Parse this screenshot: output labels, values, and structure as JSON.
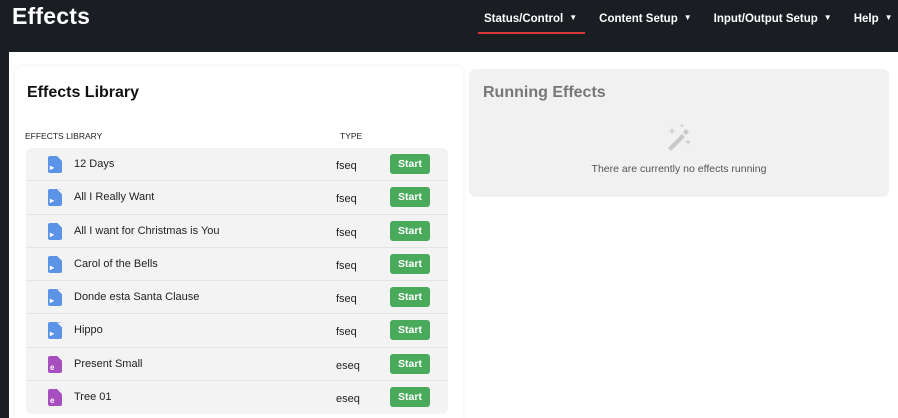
{
  "app": {
    "brand": "Effects"
  },
  "nav": [
    {
      "label": "Status/Control",
      "active": true
    },
    {
      "label": "Content Setup",
      "active": false
    },
    {
      "label": "Input/Output Setup",
      "active": false
    },
    {
      "label": "Help",
      "active": false
    }
  ],
  "caret": "▼",
  "library": {
    "title": "Effects Library",
    "col_name": "EFFECTS LIBRARY",
    "col_type": "TYPE",
    "start_label": "Start",
    "items": [
      {
        "name": "12 Days",
        "type": "fseq"
      },
      {
        "name": "All I Really Want",
        "type": "fseq"
      },
      {
        "name": "All I want for Christmas is You",
        "type": "fseq"
      },
      {
        "name": "Carol of the Bells",
        "type": "fseq"
      },
      {
        "name": "Donde esta Santa Clause",
        "type": "fseq"
      },
      {
        "name": "Hippo",
        "type": "fseq"
      },
      {
        "name": "Present Small",
        "type": "eseq"
      },
      {
        "name": "Tree 01",
        "type": "eseq"
      }
    ]
  },
  "running": {
    "title": "Running Effects",
    "empty_text": "There are currently no effects running",
    "icon": "magic-wand-icon"
  },
  "colors": {
    "nav_bg": "#1a1d22",
    "active_underline": "#d73838",
    "start_button": "#4aaa5c",
    "fseq_icon": "#5b93e6",
    "eseq_icon": "#a84fbf"
  },
  "icons": {
    "fseq": "file-video-icon",
    "eseq": "file-effect-icon"
  }
}
